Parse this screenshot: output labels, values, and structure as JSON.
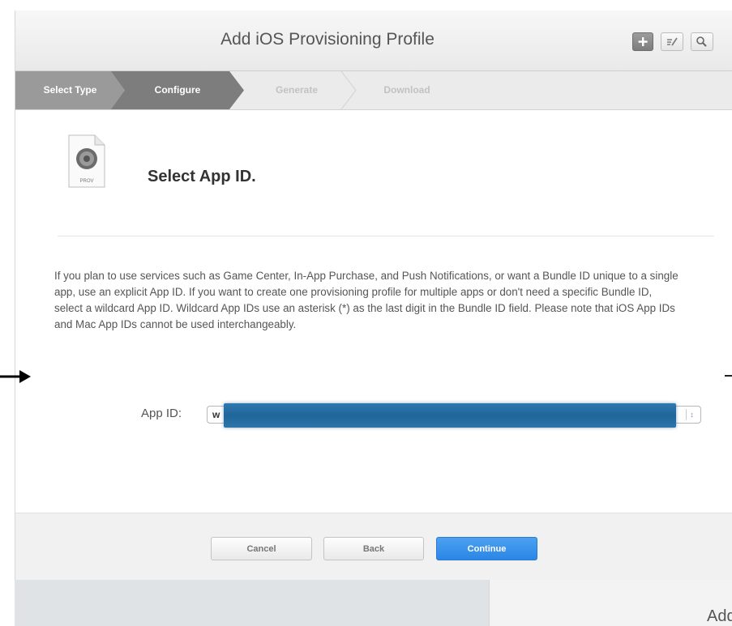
{
  "window": {
    "title": "Add iOS Provisioning Profile"
  },
  "toolbar": {
    "buttons": [
      {
        "name": "add",
        "icon": "plus-icon"
      },
      {
        "name": "edit",
        "icon": "edit-icon"
      },
      {
        "name": "search",
        "icon": "search-icon"
      }
    ]
  },
  "steps": [
    {
      "label": "Select Type",
      "state": "done"
    },
    {
      "label": "Configure",
      "state": "active"
    },
    {
      "label": "Generate",
      "state": "todo"
    },
    {
      "label": "Download",
      "state": "todo"
    }
  ],
  "section": {
    "icon": "provisioning-profile-icon",
    "icon_label": "PROV",
    "title": "Select App ID."
  },
  "description": "If you plan to use services such as Game Center, In-App Purchase, and Push Notifications, or want a Bundle ID unique to a single app, use an explicit App ID. If you want to create one provisioning profile for multiple apps or don't need a specific Bundle ID, select a wildcard App ID. Wildcard App IDs use an asterisk (*) as the last digit in the Bundle ID field. Please note that iOS App IDs and Mac App IDs cannot be used interchangeably.",
  "app_id": {
    "label": "App ID:",
    "value": "w"
  },
  "footer": {
    "cancel_label": "Cancel",
    "back_label": "Back",
    "continue_label": "Continue"
  },
  "background": {
    "partial_title": "Add"
  },
  "colors": {
    "accent": "#2b86e6",
    "redaction": "#1f669a"
  }
}
